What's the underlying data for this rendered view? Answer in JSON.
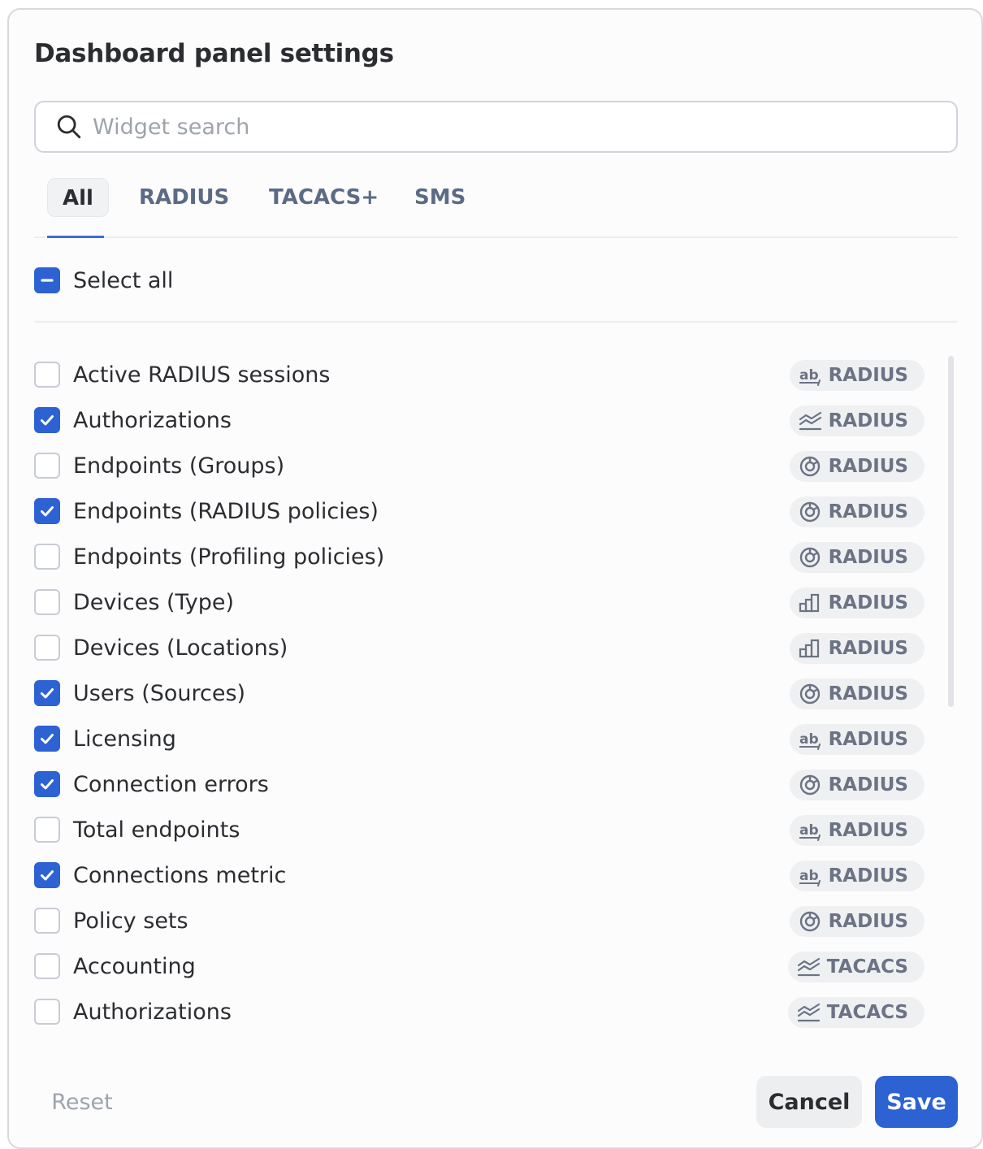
{
  "dialog": {
    "title": "Dashboard panel settings"
  },
  "search": {
    "placeholder": "Widget search",
    "value": "",
    "icon": "search-icon"
  },
  "tabs": [
    {
      "label": "All",
      "active": true
    },
    {
      "label": "RADIUS",
      "active": false
    },
    {
      "label": "TACACS+",
      "active": false
    },
    {
      "label": "SMS",
      "active": false
    }
  ],
  "select_all": {
    "label": "Select all",
    "state": "indeterminate"
  },
  "widgets": [
    {
      "label": "Active RADIUS sessions",
      "checked": false,
      "icon": "text-metric-icon",
      "tag": "RADIUS"
    },
    {
      "label": "Authorizations",
      "checked": true,
      "icon": "line-chart-icon",
      "tag": "RADIUS"
    },
    {
      "label": "Endpoints (Groups)",
      "checked": false,
      "icon": "donut-chart-icon",
      "tag": "RADIUS"
    },
    {
      "label": "Endpoints (RADIUS policies)",
      "checked": true,
      "icon": "donut-chart-icon",
      "tag": "RADIUS"
    },
    {
      "label": "Endpoints (Profiling policies)",
      "checked": false,
      "icon": "donut-chart-icon",
      "tag": "RADIUS"
    },
    {
      "label": "Devices (Type)",
      "checked": false,
      "icon": "bar-chart-icon",
      "tag": "RADIUS"
    },
    {
      "label": "Devices (Locations)",
      "checked": false,
      "icon": "bar-chart-icon",
      "tag": "RADIUS"
    },
    {
      "label": "Users (Sources)",
      "checked": true,
      "icon": "donut-chart-icon",
      "tag": "RADIUS"
    },
    {
      "label": "Licensing",
      "checked": true,
      "icon": "text-metric-icon",
      "tag": "RADIUS"
    },
    {
      "label": "Connection errors",
      "checked": true,
      "icon": "donut-chart-icon",
      "tag": "RADIUS"
    },
    {
      "label": "Total endpoints",
      "checked": false,
      "icon": "text-metric-icon",
      "tag": "RADIUS"
    },
    {
      "label": "Connections metric",
      "checked": true,
      "icon": "text-metric-icon",
      "tag": "RADIUS"
    },
    {
      "label": "Policy sets",
      "checked": false,
      "icon": "donut-chart-icon",
      "tag": "RADIUS"
    },
    {
      "label": "Accounting",
      "checked": false,
      "icon": "line-chart-icon",
      "tag": "TACACS"
    },
    {
      "label": "Authorizations",
      "checked": false,
      "icon": "line-chart-icon",
      "tag": "TACACS"
    }
  ],
  "footer": {
    "reset_label": "Reset",
    "cancel_label": "Cancel",
    "save_label": "Save"
  },
  "colors": {
    "accent": "#2d62d3",
    "badge_bg": "#eef0f2",
    "badge_text": "#6b7384"
  }
}
